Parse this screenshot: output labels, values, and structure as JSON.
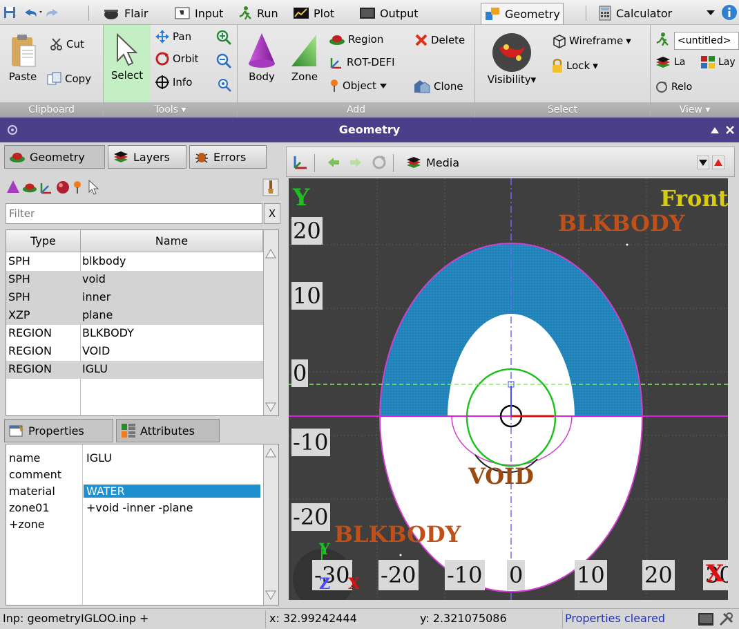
{
  "app": {
    "window_title": "Geometry"
  },
  "quick_access": {
    "save": "save-icon",
    "undo": "undo-icon",
    "redo": "redo-icon"
  },
  "tabs": [
    {
      "label": "Flair"
    },
    {
      "label": "Input"
    },
    {
      "label": "Run"
    },
    {
      "label": "Plot"
    },
    {
      "label": "Output"
    },
    {
      "label": "Geometry"
    },
    {
      "label": "Calculator"
    }
  ],
  "ribbon": {
    "clipboard": {
      "title": "Clipboard",
      "paste": "Paste",
      "cut": "Cut",
      "copy": "Copy"
    },
    "tools": {
      "title": "Tools",
      "select": "Select",
      "pan": "Pan",
      "orbit": "Orbit",
      "info": "Info"
    },
    "add": {
      "title": "Add",
      "body": "Body",
      "zone": "Zone",
      "region": "Region",
      "rotdefi": "ROT-DEFI",
      "object": "Object",
      "delete": "Delete",
      "clone": "Clone"
    },
    "select": {
      "title": "Select",
      "visibility": "Visibility",
      "wireframe": "Wireframe",
      "lock": "Lock"
    },
    "view": {
      "title": "View",
      "untitled": "<untitled>",
      "la": "La",
      "lay": "Lay",
      "relo": "Relo"
    }
  },
  "left": {
    "tabs": {
      "geometry": "Geometry",
      "layers": "Layers",
      "errors": "Errors"
    },
    "filter_placeholder": "Filter",
    "filter_clear": "X",
    "table": {
      "headers": {
        "type": "Type",
        "name": "Name"
      },
      "rows": [
        {
          "type": "SPH",
          "name": "blkbody"
        },
        {
          "type": "SPH",
          "name": "void"
        },
        {
          "type": "SPH",
          "name": "inner"
        },
        {
          "type": "XZP",
          "name": "plane"
        },
        {
          "type": "REGION",
          "name": "BLKBODY"
        },
        {
          "type": "REGION",
          "name": "VOID"
        },
        {
          "type": "REGION",
          "name": "IGLU"
        }
      ]
    },
    "prop_tabs": {
      "properties": "Properties",
      "attributes": "Attributes"
    },
    "properties": [
      {
        "key": "name",
        "value": "IGLU"
      },
      {
        "key": "comment",
        "value": ""
      },
      {
        "key": "material",
        "value": "WATER"
      },
      {
        "key": "zone01",
        "value": "+void -inner -plane"
      },
      {
        "key": "+zone",
        "value": ""
      }
    ]
  },
  "viewport": {
    "layer": "Media",
    "view_name": "Front",
    "axis_y": "Y",
    "axis_x_marker": "X",
    "labels": {
      "blkbody_top": "BLKBODY",
      "void": "VOID",
      "blkbody_bottom": "BLKBODY"
    },
    "yticks": [
      "20",
      "10",
      "0",
      "-10",
      "-20"
    ],
    "xticks": [
      "-30",
      "-20",
      "-10",
      "0",
      "10",
      "20",
      "30"
    ],
    "triad": {
      "y": "Y",
      "z": "Z",
      "x": "X"
    }
  },
  "status": {
    "input": "Inp: geometryIGLOO.inp +",
    "x": "x: 32.99242444",
    "y": "y: 2.321075086",
    "message": "Properties cleared"
  }
}
